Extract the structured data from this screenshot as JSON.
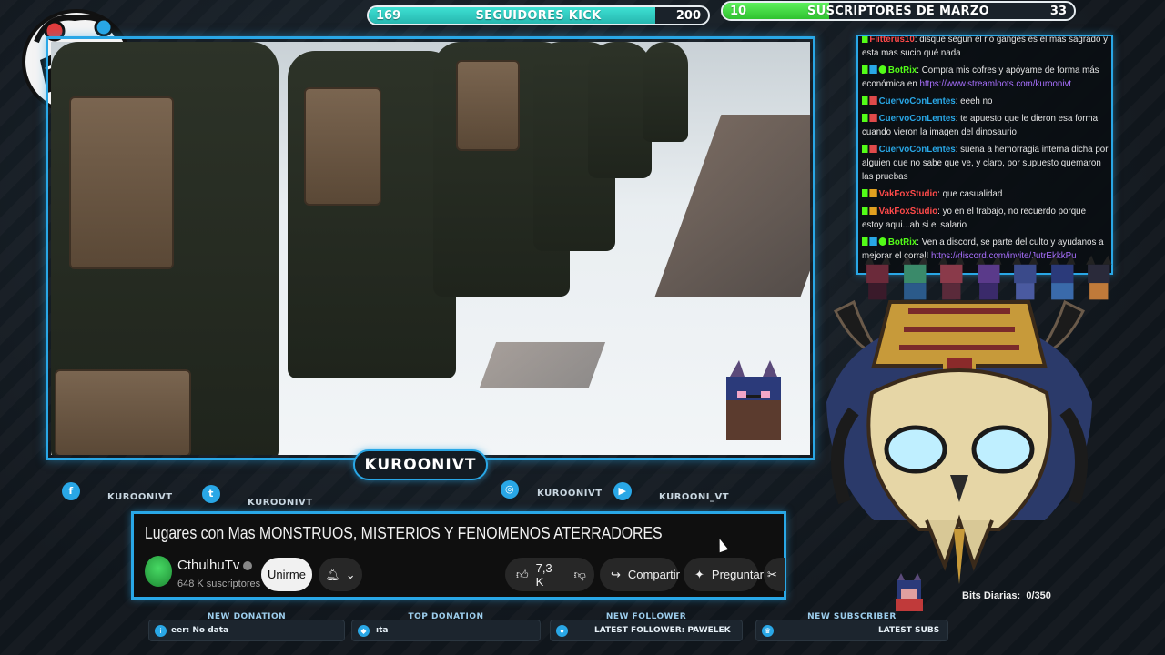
{
  "overlay": {
    "kick_goal": {
      "current": "169",
      "label": "SEGUIDORES KICK",
      "target": "200",
      "progress": 0.845
    },
    "subs_goal": {
      "current": "10",
      "label": "SUSCRIPTORES DE MARZO",
      "target": "33",
      "progress": 0.303
    },
    "channel_name": "KUROONIVT",
    "socials": [
      {
        "icon": "facebook-icon",
        "glyph": "f",
        "handle": "KUROONIVT"
      },
      {
        "icon": "twitter-icon",
        "glyph": "t",
        "handle": "KUROONIVT"
      },
      {
        "icon": "instagram-icon",
        "glyph": "◎",
        "handle": "KUROONIVT"
      },
      {
        "icon": "youtube-icon",
        "glyph": "▶",
        "handle": "KUROONI_VT"
      }
    ],
    "alerts": [
      {
        "head": "NEW DONATION",
        "icon": "donation-icon",
        "value": "eer: No data"
      },
      {
        "head": "TOP DONATION",
        "icon": "top-donation-icon",
        "value": "ıta"
      },
      {
        "head": "NEW FOLLOWER",
        "icon": "follower-icon",
        "value": "LATEST FOLLOWER: PAWELEK"
      },
      {
        "head": "NEW SUBSCRIBER",
        "icon": "crown-icon",
        "value": "LATEST SUBS"
      }
    ],
    "bits": {
      "label": "Bits Diarias:",
      "value": "0/350"
    },
    "colors": {
      "accent": "#29a7e6",
      "kick_fill": "#3de0d2",
      "subs_fill": "#5cf05c"
    }
  },
  "youtube": {
    "video_title": "Lugares con Mas MONSTRUOS, MISTERIOS Y FENOMENOS ATERRADORES",
    "channel": "CthulhuTv",
    "subscribers": "648 K suscriptores",
    "join_label": "Unirme",
    "likes": "7,3 K",
    "share_label": "Compartir",
    "ask_label": "Preguntar"
  },
  "chat": {
    "messages": [
      {
        "user": "Flitterus10",
        "user_color": "#ff4a4a",
        "text": ": disque según el rio ganges es el mas sagrado y esta mas sucio qué nada",
        "link": ""
      },
      {
        "user": "BotRix",
        "user_color": "#53fc18",
        "text": ": Compra mis cofres y apóyame de forma más económica en ",
        "link": "https://www.streamloots.com/kuroonivt"
      },
      {
        "user": "CuervoConLentes",
        "user_color": "#29a7e6",
        "text": ": eeeh no",
        "link": ""
      },
      {
        "user": "CuervoConLentes",
        "user_color": "#29a7e6",
        "text": ": te apuesto que le dieron esa forma cuando vieron la imagen del dinosaurio",
        "link": ""
      },
      {
        "user": "CuervoConLentes",
        "user_color": "#29a7e6",
        "text": ": suena a hemorragia interna dicha por alguien que no sabe que ve, y claro, por supuesto quemaron las pruebas",
        "link": ""
      },
      {
        "user": "VakFoxStudio",
        "user_color": "#ff4a4a",
        "text": ": que casualidad",
        "link": ""
      },
      {
        "user": "VakFoxStudio",
        "user_color": "#ff4a4a",
        "text": ": yo en el trabajo, no recuerdo porque estoy aqui...ah si el salario",
        "link": ""
      },
      {
        "user": "BotRix",
        "user_color": "#53fc18",
        "text": ": Ven a discord, se parte del culto y ayudanos a mejorar el corral! ",
        "link": "https://discord.com/invite/JutrEkkkPu"
      }
    ]
  }
}
